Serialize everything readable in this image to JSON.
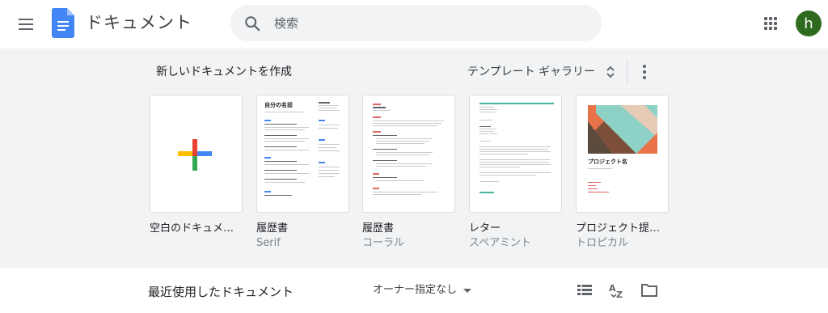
{
  "header": {
    "menu_icon": "hamburger-menu-icon",
    "logo_icon": "google-docs-logo",
    "app_title": "ドキュメント",
    "search": {
      "placeholder": "検索",
      "value": ""
    },
    "apps_icon": "apps-grid-icon",
    "avatar_letter": "h",
    "avatar_color": "#2e6b1f"
  },
  "gallery": {
    "title": "新しいドキュメントを作成",
    "toggle_label": "テンプレート ギャラリー",
    "toggle_icon": "unfold-more-icon",
    "more_icon": "more-vert-icon",
    "templates": [
      {
        "name": "空白のドキュメ…",
        "subtitle": ""
      },
      {
        "name": "履歴書",
        "subtitle": "Serif",
        "thumb_heading": "自分の名前"
      },
      {
        "name": "履歴書",
        "subtitle": "コーラル"
      },
      {
        "name": "レター",
        "subtitle": "スペアミント"
      },
      {
        "name": "プロジェクト提…",
        "subtitle": "トロピカル",
        "thumb_heading": "プロジェクト名"
      }
    ]
  },
  "recent": {
    "title": "最近使用したドキュメント",
    "owner_filter": "オーナー指定なし",
    "list_view_icon": "list-view-icon",
    "sort_icon": "sort-az-icon",
    "folder_icon": "folder-icon"
  },
  "colors": {
    "accent_blue": "#4285f4",
    "accent_red": "#ea4335",
    "accent_yellow": "#fbbc04",
    "accent_green": "#34a853",
    "gallery_bg": "#f1f3f4"
  }
}
